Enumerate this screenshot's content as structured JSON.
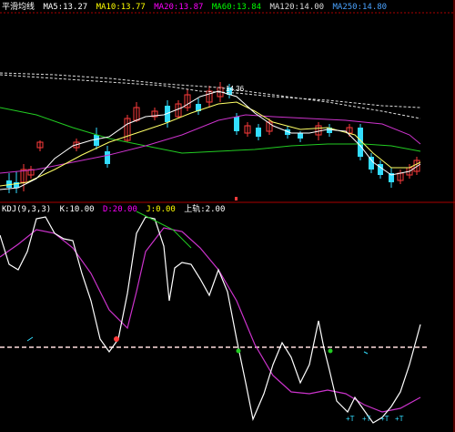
{
  "top_panel": {
    "indicator_name": "平滑均线",
    "params": [
      {
        "text": "MA5:13.27",
        "color": "#ffffff"
      },
      {
        "text": "MA10:13.77",
        "color": "#ffff00"
      },
      {
        "text": "MA20:13.87",
        "color": "#ff00ff"
      },
      {
        "text": "MA60:13.84",
        "color": "#00ff00"
      },
      {
        "text": "MA120:14.00",
        "color": "#dddddd"
      },
      {
        "text": "MA250:14.80",
        "color": "#4aa3ff"
      }
    ],
    "price_tag": "14.36"
  },
  "bottom_panel": {
    "params": [
      {
        "text": "KDJ(9,3,3)",
        "color": "#ffffff"
      },
      {
        "text": "K:10.00",
        "color": "#ffffff"
      },
      {
        "text": "D:20.00",
        "color": "#ff00ff"
      },
      {
        "text": "J:0.00",
        "color": "#ffff00"
      },
      {
        "text": "上轨:2.00",
        "color": "#ffffff"
      }
    ],
    "markers": [
      "+T",
      "+T",
      "+T",
      "+T"
    ]
  },
  "colors": {
    "background": "#000000",
    "divider": "#aa0000",
    "up": "#ff3b3b",
    "down": "#33ddff",
    "white_line": "#ffffff",
    "yellow_line": "#ffff66",
    "magenta_line": "#cc33cc",
    "green_line": "#22cc22",
    "ref_line": "#ffdddd"
  }
}
